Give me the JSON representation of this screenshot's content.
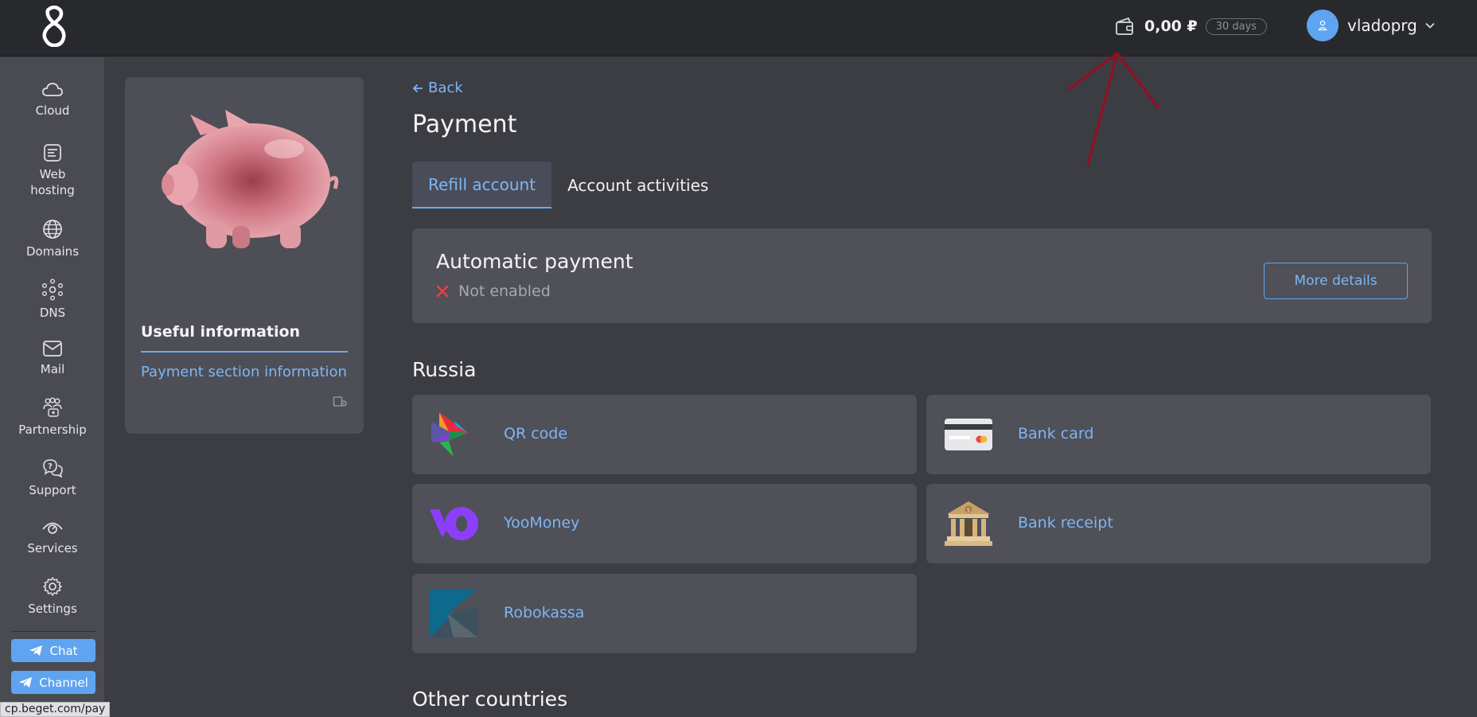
{
  "header": {
    "balance": "0,00 ₽",
    "days_badge": "30 days",
    "username": "vladoprg"
  },
  "sidebar": {
    "items": [
      {
        "label": "Cloud",
        "icon": "cloud-icon"
      },
      {
        "label": "Web\nhosting",
        "icon": "hosting-icon"
      },
      {
        "label": "Domains",
        "icon": "globe-icon"
      },
      {
        "label": "DNS",
        "icon": "dns-icon"
      },
      {
        "label": "Mail",
        "icon": "mail-icon"
      },
      {
        "label": "Partnership",
        "icon": "partnership-icon"
      },
      {
        "label": "Support",
        "icon": "support-icon"
      },
      {
        "label": "Services",
        "icon": "services-icon"
      },
      {
        "label": "Settings",
        "icon": "gear-icon"
      }
    ],
    "chat_label": "Chat",
    "channel_label": "Channel"
  },
  "status_url": "cp.beget.com/pay",
  "info_card": {
    "title": "Useful information",
    "link": "Payment section information"
  },
  "main": {
    "back_label": "Back",
    "title": "Payment",
    "tabs": [
      {
        "label": "Refill account",
        "active": true
      },
      {
        "label": "Account activities",
        "active": false
      }
    ],
    "auto_payment": {
      "title": "Automatic payment",
      "status": "Not enabled",
      "button": "More details"
    },
    "russia_title": "Russia",
    "methods": [
      {
        "label": "QR code",
        "icon": "qr-sbp-icon"
      },
      {
        "label": "Bank card",
        "icon": "bank-card-icon"
      },
      {
        "label": "YooMoney",
        "icon": "yoomoney-icon"
      },
      {
        "label": "Bank receipt",
        "icon": "bank-building-icon"
      },
      {
        "label": "Robokassa",
        "icon": "robokassa-icon"
      }
    ],
    "other_title": "Other countries"
  },
  "colors": {
    "accent": "#5ea4f0",
    "link": "#7db6f6",
    "topbar": "#28292d",
    "sidebar": "#4a4b52",
    "card": "#4f5058",
    "annotation_arrow": "#8c1224"
  }
}
